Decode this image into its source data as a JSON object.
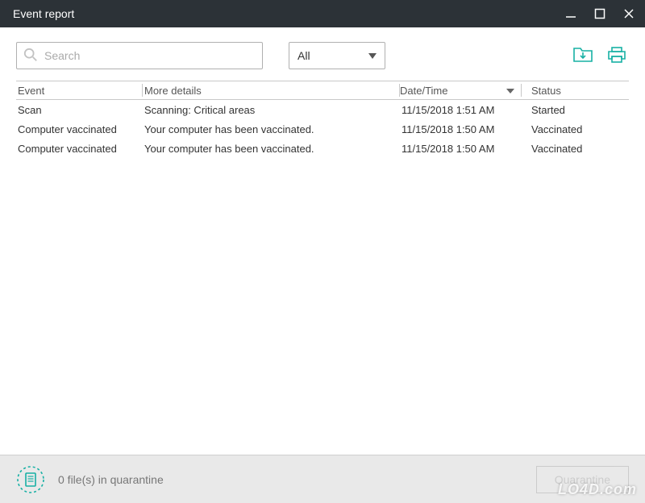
{
  "window": {
    "title": "Event report"
  },
  "toolbar": {
    "search_placeholder": "Search",
    "filter_selected": "All"
  },
  "table": {
    "headers": {
      "event": "Event",
      "details": "More details",
      "datetime": "Date/Time",
      "status": "Status"
    },
    "rows": [
      {
        "event": "Scan",
        "details": "Scanning: Critical areas",
        "datetime": "11/15/2018 1:51 AM",
        "status": "Started"
      },
      {
        "event": "Computer vaccinated",
        "details": "Your computer has been vaccinated.",
        "datetime": "11/15/2018 1:50 AM",
        "status": "Vaccinated"
      },
      {
        "event": "Computer vaccinated",
        "details": "Your computer has been vaccinated.",
        "datetime": "11/15/2018 1:50 AM",
        "status": "Vaccinated"
      }
    ]
  },
  "quarantine": {
    "text": "0 file(s) in quarantine",
    "button": "Quarantine"
  },
  "watermark": "LO4D.com",
  "colors": {
    "accent": "#17b0a4",
    "titlebar": "#2c3237"
  }
}
